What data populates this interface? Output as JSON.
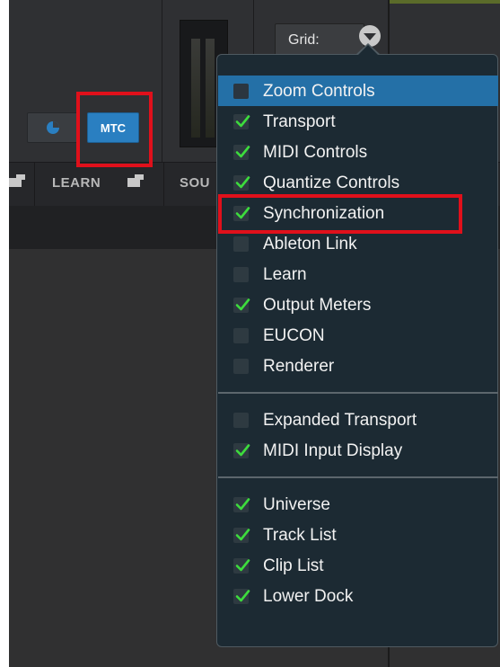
{
  "toolbar": {
    "mtc_label": "MTC",
    "grid_label": "Grid:",
    "learn_label": "LEARN",
    "sou_label": "SOU"
  },
  "menu": {
    "section1": [
      {
        "label": "Zoom Controls",
        "checked": false,
        "highlighted": true
      },
      {
        "label": "Transport",
        "checked": true
      },
      {
        "label": "MIDI Controls",
        "checked": true
      },
      {
        "label": "Quantize Controls",
        "checked": true
      },
      {
        "label": "Synchronization",
        "checked": true
      },
      {
        "label": "Ableton Link",
        "checked": false
      },
      {
        "label": "Learn",
        "checked": false
      },
      {
        "label": "Output Meters",
        "checked": true
      },
      {
        "label": "EUCON",
        "checked": false
      },
      {
        "label": "Renderer",
        "checked": false
      }
    ],
    "section2": [
      {
        "label": "Expanded Transport",
        "checked": false
      },
      {
        "label": "MIDI Input Display",
        "checked": true
      }
    ],
    "section3": [
      {
        "label": "Universe",
        "checked": true
      },
      {
        "label": "Track List",
        "checked": true
      },
      {
        "label": "Clip List",
        "checked": true
      },
      {
        "label": "Lower Dock",
        "checked": true
      }
    ]
  },
  "colors": {
    "accent_blue": "#2a7fc1",
    "menu_highlight": "#2470a7",
    "check_green": "#3ddc3d",
    "annotation_red": "#e0101b"
  }
}
